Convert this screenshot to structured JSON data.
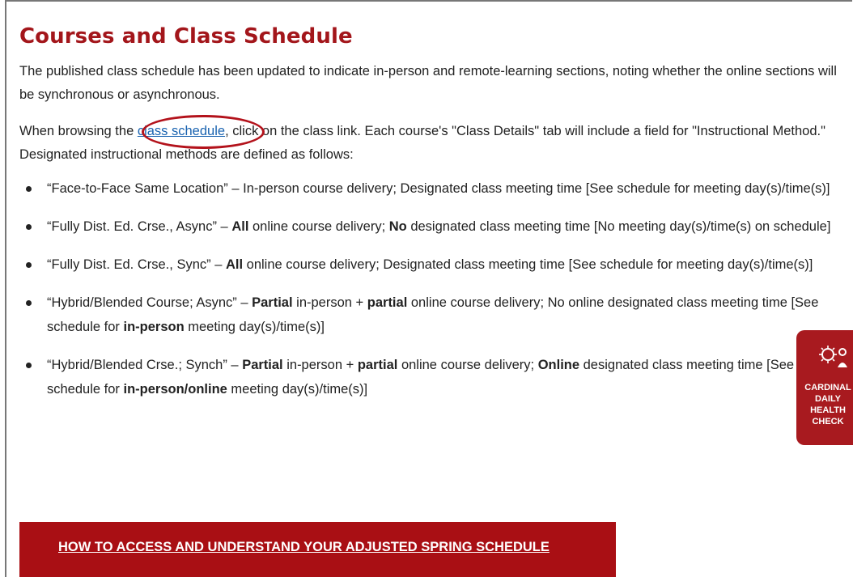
{
  "heading": "Courses and Class Schedule",
  "intro": "The published class schedule has been updated to indicate in-person and remote-learning sections, noting whether the online sections will be synchronous or asynchronous.",
  "browse": {
    "pre": "When browsing the ",
    "link": "class schedule",
    "post": ", click on the class link. Each course's \"Class Details\" tab will include a field for \"Instructional Method.\" Designated instructional methods are defined as follows:"
  },
  "methods": [
    {
      "name": "“Face-to-Face Same Location” – ",
      "a": "In-person course delivery; Designated class meeting time [See schedule for meeting day(s)/time(s)]"
    },
    {
      "name": "“Fully Dist. Ed. Crse., Async” – ",
      "b1": "All",
      "a": " online course delivery; ",
      "b2": "No",
      "c": " designated class meeting time [No meeting day(s)/time(s) on schedule]"
    },
    {
      "name": "“Fully Dist. Ed. Crse., Sync” – ",
      "b1": "All",
      "a": " online course delivery; Designated class meeting time [See schedule for meeting day(s)/time(s)]"
    },
    {
      "name": "“Hybrid/Blended Course; Async” – ",
      "b1": "Partial",
      "a": " in-person + ",
      "b2": "partial",
      "c": " online course delivery; No online designated class meeting time [See schedule for ",
      "b3": "in-person",
      "d": " meeting day(s)/time(s)]"
    },
    {
      "name": "“Hybrid/Blended Crse.; Synch” – ",
      "b1": "Partial",
      "a": " in-person + ",
      "b2": "partial",
      "c": " online course delivery; ",
      "b3": "Online",
      "d": " designated class meeting time [See schedule for ",
      "b4": "in-person/online",
      "e": " meeting day(s)/time(s)]"
    }
  ],
  "banner": "HOW TO ACCESS AND UNDERSTAND YOUR ADJUSTED SPRING SCHEDULE",
  "health_widget": "CARDINAL\nDAILY\nHEALTH\nCHECK",
  "colors": {
    "accent": "#a3161b",
    "link": "#1a63b0",
    "banner": "#a90f14"
  }
}
